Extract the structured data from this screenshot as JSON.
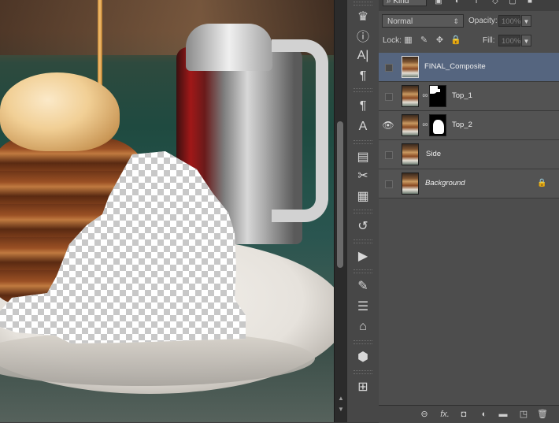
{
  "canvas": {
    "description_icon": "image-canvas"
  },
  "layers_panel": {
    "filter_kind": "Kind",
    "blend_mode": "Normal",
    "opacity_label": "Opacity:",
    "opacity_value": "100%",
    "lock_label": "Lock:",
    "fill_label": "Fill:",
    "fill_value": "100%",
    "layers": [
      {
        "name": "FINAL_Composite",
        "visible": false,
        "selected": true,
        "mask": false,
        "italic": false,
        "locked": false
      },
      {
        "name": "Top_1",
        "visible": false,
        "selected": false,
        "mask": true,
        "italic": false,
        "locked": false
      },
      {
        "name": "Top_2",
        "visible": true,
        "selected": false,
        "mask": true,
        "italic": false,
        "locked": false
      },
      {
        "name": "Side",
        "visible": false,
        "selected": false,
        "mask": false,
        "italic": false,
        "locked": false
      },
      {
        "name": "Background",
        "visible": false,
        "selected": false,
        "mask": false,
        "italic": true,
        "locked": true
      }
    ],
    "bottom_icons": [
      "link-icon",
      "fx-icon",
      "add-mask-icon",
      "adjustment-icon",
      "group-folder-icon",
      "new-layer-icon",
      "trash-icon"
    ],
    "fx_label": "fx"
  },
  "side_strip": {
    "icons": [
      "history-icon",
      "info-icon",
      "character-icon",
      "paragraph-icon",
      "paragraph-styles-icon",
      "character-styles-icon",
      "notes-icon",
      "tool-presets-icon",
      "properties-icon",
      "history-brush-icon",
      "actions-play-icon",
      "brush-icon",
      "adjustments-icon",
      "clone-source-icon",
      "3d-icon",
      "measurement-icon"
    ]
  },
  "colors": {
    "panel_bg": "#4d4d4d",
    "selected_row": "#55657f"
  }
}
